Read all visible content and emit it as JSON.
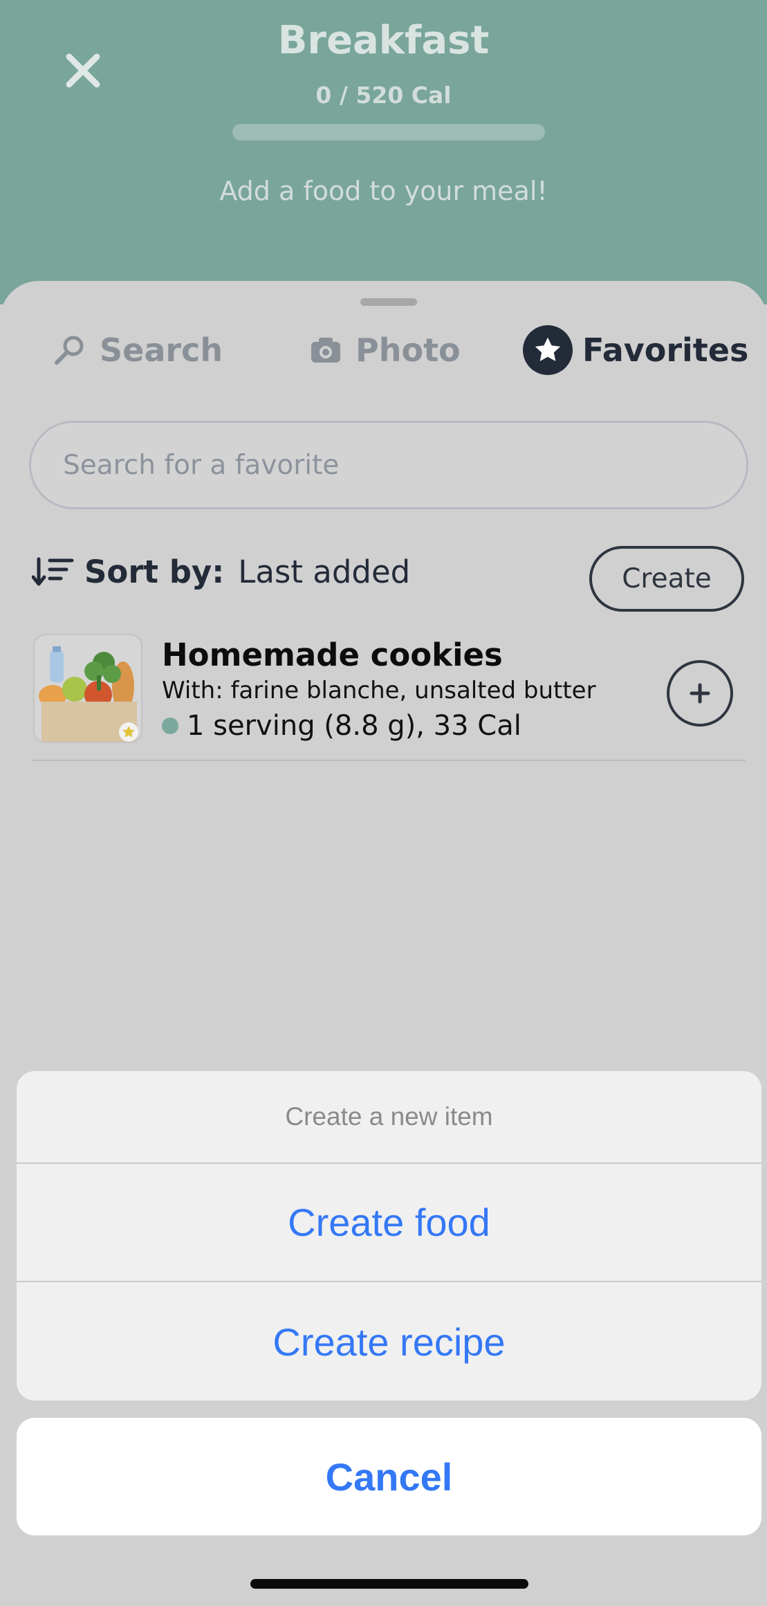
{
  "header": {
    "title": "Breakfast",
    "calories": "0 / 520 Cal",
    "progress_fraction": 0,
    "hint": "Add a food to your meal!"
  },
  "tabs": [
    {
      "label": "Search",
      "icon": "search-icon",
      "active": false
    },
    {
      "label": "Photo",
      "icon": "camera-icon",
      "active": false
    },
    {
      "label": "Favorites",
      "icon": "star-icon",
      "active": true
    }
  ],
  "search": {
    "placeholder": "Search for a favorite"
  },
  "sort": {
    "label": "Sort by:",
    "value": "Last added"
  },
  "create_button": "Create",
  "favorites": [
    {
      "name": "Homemade cookies",
      "with": "With: farine blanche, unsalted butter",
      "serving": "1 serving (8.8 g), 33 Cal",
      "thumbnail": "groceries-bag-icon"
    }
  ],
  "action_sheet": {
    "title": "Create a new item",
    "items": [
      "Create food",
      "Create recipe"
    ],
    "cancel": "Cancel"
  },
  "colors": {
    "header_bg": "#79a59b",
    "accent_blue": "#3478f6",
    "dark_text": "#232b39",
    "serving_dot": "#7aa89d"
  }
}
